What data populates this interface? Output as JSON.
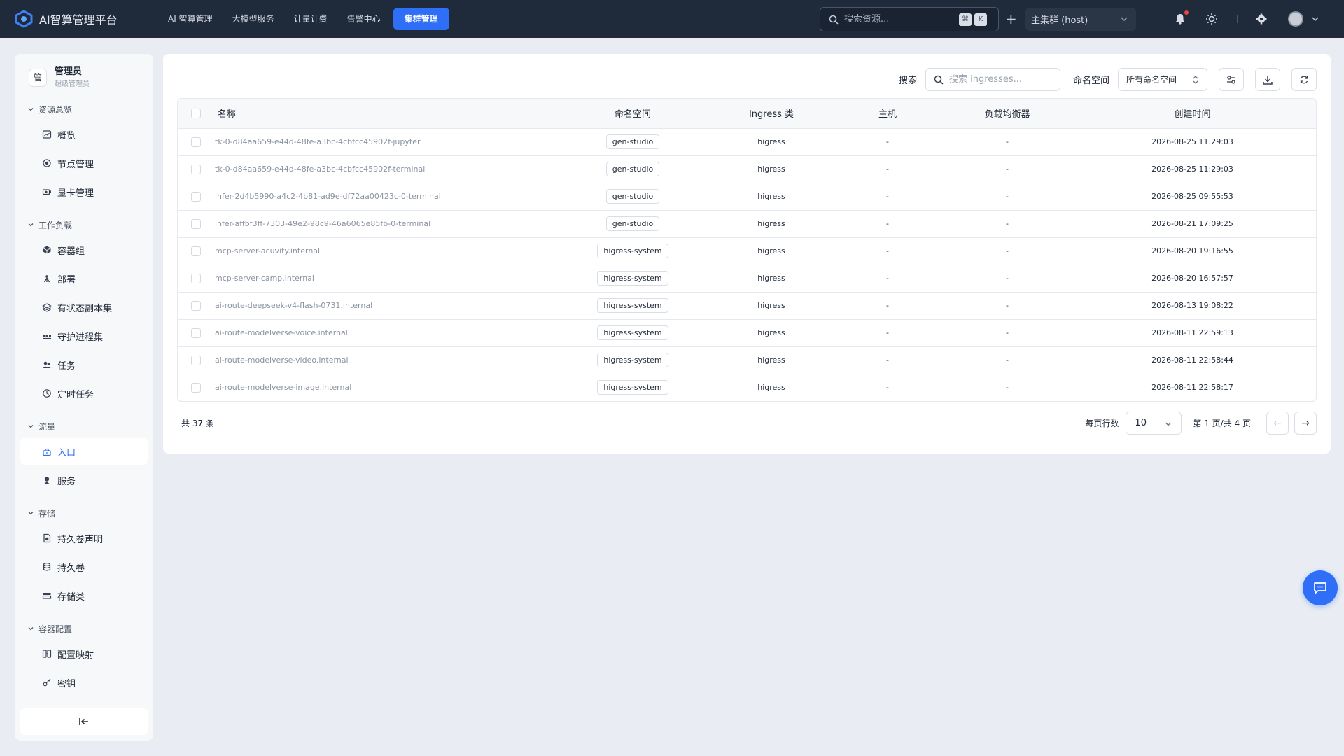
{
  "app": {
    "title": "AI智算管理平台"
  },
  "topnav": [
    {
      "label": "AI 智算管理",
      "active": false
    },
    {
      "label": "大模型服务",
      "active": false
    },
    {
      "label": "计量计费",
      "active": false
    },
    {
      "label": "告警中心",
      "active": false
    },
    {
      "label": "集群管理",
      "active": true
    }
  ],
  "top_search": {
    "placeholder": "搜索资源...",
    "kbd1": "⌘",
    "kbd2": "K"
  },
  "top_plus": "+",
  "cluster": {
    "selected": "主集群 (host)"
  },
  "user": {
    "badge": "管",
    "name": "管理员",
    "role": "超级管理员"
  },
  "sidebar": {
    "groups": [
      {
        "title": "资源总览",
        "items": [
          {
            "label": "概览",
            "icon": "dashboard-icon"
          },
          {
            "label": "节点管理",
            "icon": "node-icon"
          },
          {
            "label": "显卡管理",
            "icon": "gpu-icon"
          }
        ]
      },
      {
        "title": "工作负载",
        "items": [
          {
            "label": "容器组",
            "icon": "pod-icon"
          },
          {
            "label": "部署",
            "icon": "deploy-icon"
          },
          {
            "label": "有状态副本集",
            "icon": "statefulset-icon"
          },
          {
            "label": "守护进程集",
            "icon": "daemonset-icon"
          },
          {
            "label": "任务",
            "icon": "job-icon"
          },
          {
            "label": "定时任务",
            "icon": "cronjob-icon"
          }
        ]
      },
      {
        "title": "流量",
        "items": [
          {
            "label": "入口",
            "icon": "ingress-icon",
            "active": true
          },
          {
            "label": "服务",
            "icon": "service-icon"
          }
        ]
      },
      {
        "title": "存储",
        "items": [
          {
            "label": "持久卷声明",
            "icon": "pvc-icon"
          },
          {
            "label": "持久卷",
            "icon": "pv-icon"
          },
          {
            "label": "存储类",
            "icon": "storageclass-icon"
          }
        ]
      },
      {
        "title": "容器配置",
        "items": [
          {
            "label": "配置映射",
            "icon": "configmap-icon"
          },
          {
            "label": "密钥",
            "icon": "secret-icon"
          }
        ]
      }
    ]
  },
  "toolbar": {
    "search_label": "搜索",
    "search_placeholder": "搜索 ingresses...",
    "namespace_label": "命名空间",
    "namespace_selected": "所有命名空间"
  },
  "table": {
    "columns": [
      "名称",
      "命名空间",
      "Ingress 类",
      "主机",
      "负载均衡器",
      "创建时间"
    ],
    "rows": [
      {
        "name": "tk-0-d84aa659-e44d-48fe-a3bc-4cbfcc45902f-jupyter",
        "namespace": "gen-studio",
        "class": "higress",
        "host": "-",
        "lb": "-",
        "created": "2026-08-25 11:29:03"
      },
      {
        "name": "tk-0-d84aa659-e44d-48fe-a3bc-4cbfcc45902f-terminal",
        "namespace": "gen-studio",
        "class": "higress",
        "host": "-",
        "lb": "-",
        "created": "2026-08-25 11:29:03"
      },
      {
        "name": "infer-2d4b5990-a4c2-4b81-ad9e-df72aa00423c-0-terminal",
        "namespace": "gen-studio",
        "class": "higress",
        "host": "-",
        "lb": "-",
        "created": "2026-08-25 09:55:53"
      },
      {
        "name": "infer-affbf3ff-7303-49e2-98c9-46a6065e85fb-0-terminal",
        "namespace": "gen-studio",
        "class": "higress",
        "host": "-",
        "lb": "-",
        "created": "2026-08-21 17:09:25"
      },
      {
        "name": "mcp-server-acuvity.internal",
        "namespace": "higress-system",
        "class": "higress",
        "host": "-",
        "lb": "-",
        "created": "2026-08-20 19:16:55"
      },
      {
        "name": "mcp-server-camp.internal",
        "namespace": "higress-system",
        "class": "higress",
        "host": "-",
        "lb": "-",
        "created": "2026-08-20 16:57:57"
      },
      {
        "name": "ai-route-deepseek-v4-flash-0731.internal",
        "namespace": "higress-system",
        "class": "higress",
        "host": "-",
        "lb": "-",
        "created": "2026-08-13 19:08:22"
      },
      {
        "name": "ai-route-modelverse-voice.internal",
        "namespace": "higress-system",
        "class": "higress",
        "host": "-",
        "lb": "-",
        "created": "2026-08-11 22:59:13"
      },
      {
        "name": "ai-route-modelverse-video.internal",
        "namespace": "higress-system",
        "class": "higress",
        "host": "-",
        "lb": "-",
        "created": "2026-08-11 22:58:44"
      },
      {
        "name": "ai-route-modelverse-image.internal",
        "namespace": "higress-system",
        "class": "higress",
        "host": "-",
        "lb": "-",
        "created": "2026-08-11 22:58:17"
      }
    ]
  },
  "pagination": {
    "total": "共 37 条",
    "rows_label": "每页行数",
    "rows_value": "10",
    "page_info": "第 1 页/共 4 页",
    "prev": "←",
    "next": "→"
  },
  "colors": {
    "accent": "#2f6ef6",
    "topbar": "#1f2a3b",
    "background": "#e9edf3"
  }
}
